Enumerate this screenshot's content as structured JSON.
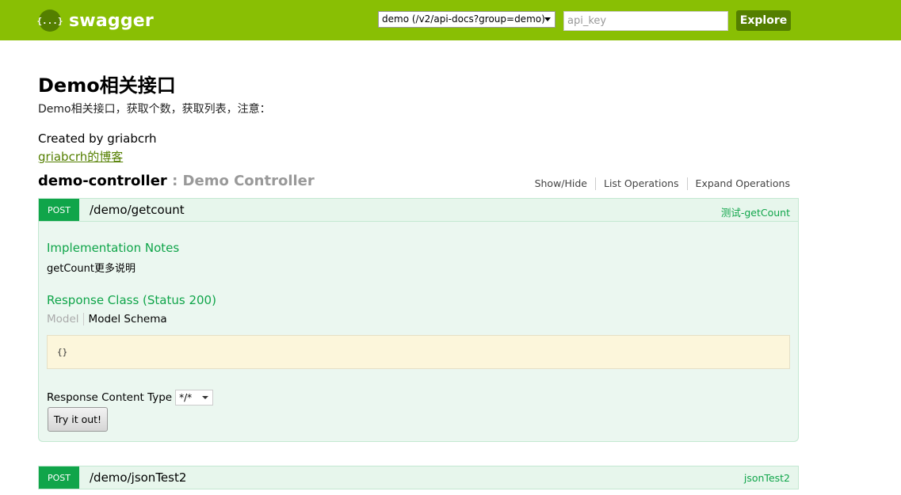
{
  "header": {
    "logo_glyph": "{...}",
    "logo_text": "swagger",
    "api_select_value": "demo (/v2/api-docs?group=demo)",
    "api_key_placeholder": "api_key",
    "explore_label": "Explore"
  },
  "info": {
    "title": "Demo相关接口",
    "description": "Demo相关接口，获取个数，获取列表，注意：",
    "created_by": "Created by griabcrh",
    "link": "griabcrh的博客"
  },
  "resource": {
    "name": "demo-controller",
    "description": " : Demo Controller",
    "ops": [
      "Show/Hide",
      "List Operations",
      "Expand Operations"
    ]
  },
  "operations": [
    {
      "method": "POST",
      "path": "/demo/getcount",
      "summary": "测试-getCount",
      "impl_notes_title": "Implementation Notes",
      "impl_notes": "getCount更多说明",
      "response_class_title": "Response Class (Status 200)",
      "tab_model": "Model",
      "tab_schema": "Model Schema",
      "schema": "{}",
      "response_content_type_label": "Response Content Type",
      "response_content_type_value": "*/*",
      "try_label": "Try it out!"
    },
    {
      "method": "POST",
      "path": "/demo/jsonTest2",
      "summary": "jsonTest2"
    }
  ],
  "colors": {
    "header_green": "#89bf04",
    "dark_green": "#547f00",
    "post_green": "#10a54a"
  }
}
